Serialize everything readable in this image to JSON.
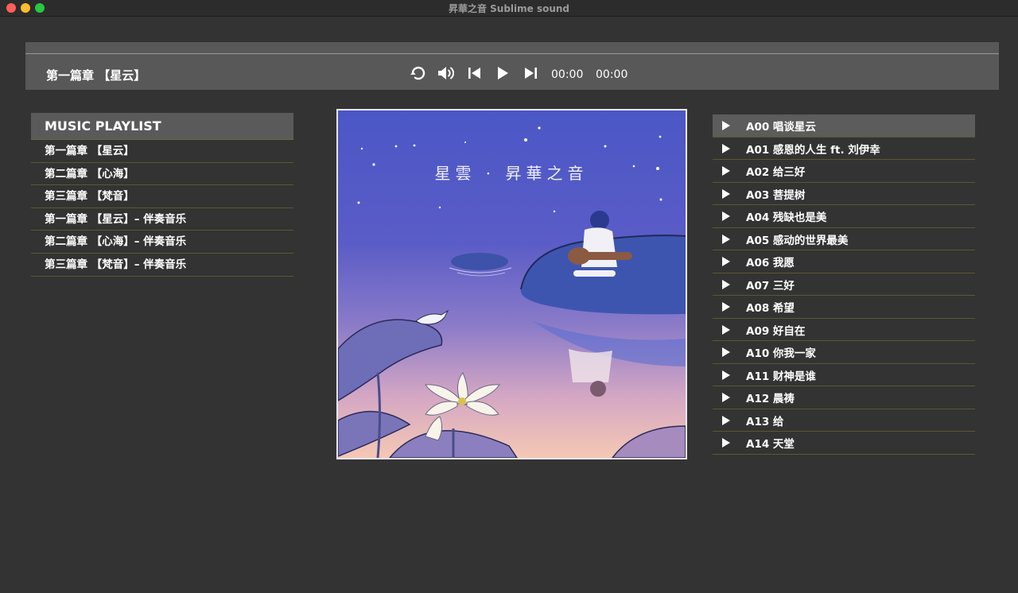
{
  "window": {
    "title": "昇華之音 Sublime sound"
  },
  "player": {
    "now_playing": "第一篇章 【星云】",
    "current_time": "00:00",
    "duration": "00:00",
    "progress": 0,
    "controls": [
      "repeat-icon",
      "volume-icon",
      "previous-icon",
      "play-icon",
      "next-icon"
    ]
  },
  "playlist": {
    "header": "MUSIC PLAYLIST",
    "items": [
      "第一篇章 【星云】",
      "第二篇章 【心海】",
      "第三篇章 【梵音】",
      "第一篇章 【星云】– 伴奏音乐",
      "第二篇章 【心海】– 伴奏音乐",
      "第三篇章 【梵音】– 伴奏音乐"
    ]
  },
  "album": {
    "title_text": "星雲 · 昇華之音"
  },
  "tracks": [
    "A00 唱谈星云",
    "A01 感恩的人生 ft. 刘伊幸",
    "A02 给三好",
    "A03 菩提树",
    "A04 残缺也是美",
    "A05 感动的世界最美",
    "A06 我愿",
    "A07 三好",
    "A08 希望",
    "A09 好自在",
    "A10 你我一家",
    "A11 财神是谁",
    "A12 晨祷",
    "A13 给",
    "A14 天堂"
  ],
  "active_track_index": 0,
  "colors": {
    "background": "#333333",
    "player_bar": "#585858",
    "divider": "#5a5834",
    "active_row": "#5c5c5c"
  }
}
